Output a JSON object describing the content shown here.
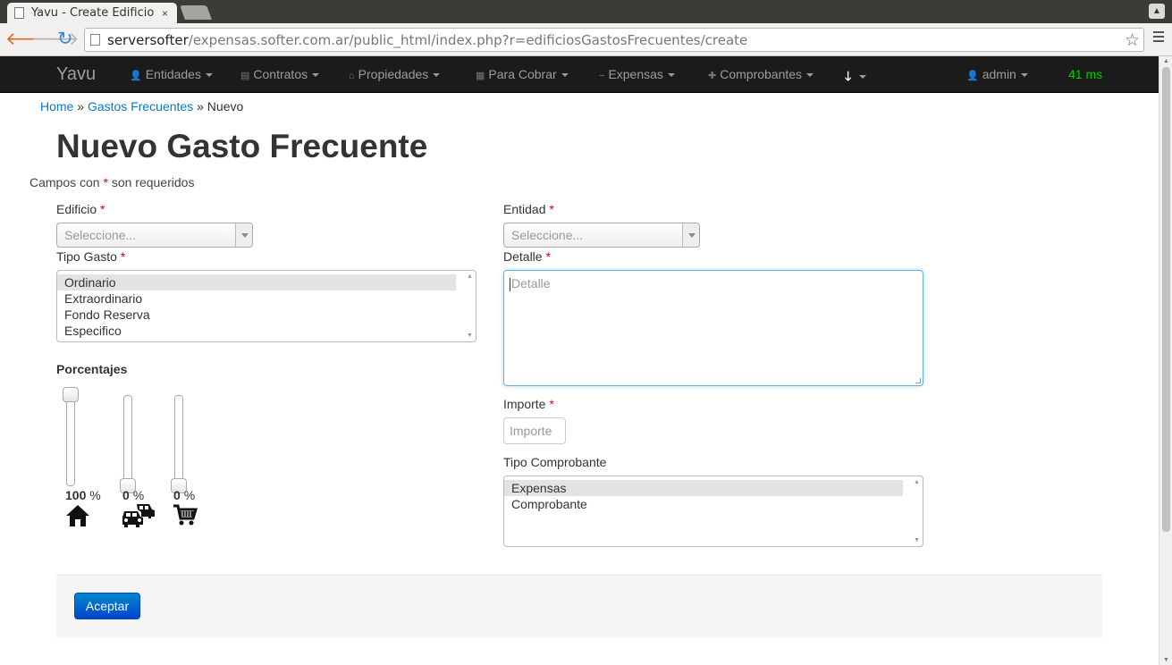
{
  "browser": {
    "tab_title": "Yavu - Create Edificio",
    "tab_close": "×",
    "url_host": "serversofter",
    "url_rest": "/expensas.softer.com.ar/public_html/index.php?r=edificiosGastosFrecuentes/create"
  },
  "navbar": {
    "brand": "Yavu",
    "items": [
      {
        "label": "Entidades",
        "icon": "user-icon"
      },
      {
        "label": "Contratos",
        "icon": "file-icon"
      },
      {
        "label": "Propiedades",
        "icon": "home-icon"
      },
      {
        "label": "Para Cobrar",
        "icon": "list-icon"
      },
      {
        "label": "Expensas",
        "icon": "minus-icon"
      },
      {
        "label": "Comprobantes",
        "icon": "plus-icon"
      },
      {
        "label": "",
        "icon": "arrow-down-icon"
      }
    ],
    "user": "admin",
    "timing": "41 ms"
  },
  "breadcrumb": {
    "home": "Home",
    "sep1": "»",
    "section": "Gastos Frecuentes",
    "sep2": "»",
    "current": "Nuevo"
  },
  "page": {
    "title": "Nuevo Gasto Frecuente",
    "required_note_pre": "Campos con ",
    "required_star": "*",
    "required_note_post": " son requeridos"
  },
  "form": {
    "edificio": {
      "label": "Edificio",
      "placeholder": "Seleccione..."
    },
    "entidad": {
      "label": "Entidad",
      "placeholder": "Seleccione..."
    },
    "tipo_gasto": {
      "label": "Tipo Gasto",
      "options": [
        "Ordinario",
        "Extraordinario",
        "Fondo Reserva",
        "Especifico"
      ],
      "selected": "Ordinario"
    },
    "detalle": {
      "label": "Detalle",
      "placeholder": "Detalle"
    },
    "importe": {
      "label": "Importe",
      "placeholder": "Importe"
    },
    "tipo_comprobante": {
      "label": "Tipo Comprobante",
      "options": [
        "Expensas",
        "Comprobante"
      ],
      "selected": "Expensas"
    },
    "porcentajes": {
      "label": "Porcentajes",
      "unit": "%",
      "sliders": [
        {
          "value": "100",
          "fraction": 1.0,
          "icon": "house-icon"
        },
        {
          "value": "0",
          "fraction": 0.0,
          "icon": "cars-icon"
        },
        {
          "value": "0",
          "fraction": 0.0,
          "icon": "shopping-cart-icon"
        }
      ]
    },
    "submit_label": "Aceptar"
  }
}
